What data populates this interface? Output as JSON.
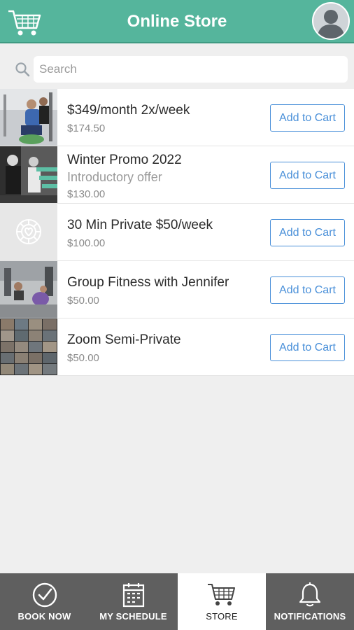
{
  "header": {
    "title": "Online Store",
    "logo_icon": "shopping-cart-icon",
    "avatar_icon": "user-avatar-icon"
  },
  "search": {
    "placeholder": "Search"
  },
  "items": [
    {
      "name": "$349/month 2x/week",
      "subtitle": "",
      "price": "$174.50",
      "button": "Add to Cart"
    },
    {
      "name": "Winter Promo 2022",
      "subtitle": "Introductory offer",
      "price": "$130.00",
      "button": "Add to Cart"
    },
    {
      "name": "30 Min Private $50/week",
      "subtitle": "",
      "price": "$100.00",
      "button": "Add to Cart"
    },
    {
      "name": "Group Fitness with Jennifer",
      "subtitle": "",
      "price": "$50.00",
      "button": "Add to Cart"
    },
    {
      "name": "Zoom Semi-Private",
      "subtitle": "",
      "price": "$50.00",
      "button": "Add to Cart"
    }
  ],
  "tabs": [
    {
      "label": "BOOK NOW",
      "icon": "check-circle-icon"
    },
    {
      "label": "MY SCHEDULE",
      "icon": "calendar-icon"
    },
    {
      "label": "STORE",
      "icon": "shopping-cart-icon",
      "active": true
    },
    {
      "label": "NOTIFICATIONS",
      "icon": "bell-icon"
    }
  ],
  "colors": {
    "header": "#55b59c",
    "button": "#4a90d9",
    "tabbar": "#5f5f5f",
    "background": "#efefef"
  }
}
